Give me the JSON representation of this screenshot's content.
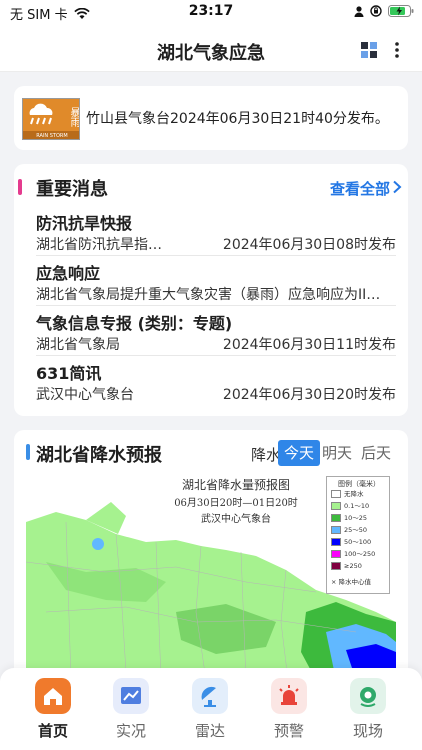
{
  "status_bar": {
    "carrier": "无 SIM 卡",
    "time": "23:17"
  },
  "nav": {
    "title": "湖北气象应急"
  },
  "notice": {
    "icon_text": "暴雨",
    "icon_banner": "RAIN STORM",
    "text": "竹山县气象台2024年06月30日21时40分发布。"
  },
  "news": {
    "title": "重要消息",
    "view_all": "查看全部",
    "items": [
      {
        "title": "防汛抗旱快报",
        "source": "湖北省防汛抗旱指…",
        "date": "2024年06月30日08时发布"
      },
      {
        "title": "应急响应",
        "source": "湖北省气象局提升重大气象灾害（暴雨）应急响应为II…",
        "date": ""
      },
      {
        "title": "气象信息专报 (类别：专题)",
        "source": "湖北省气象局",
        "date": "2024年06月30日11时发布"
      },
      {
        "title": "631简讯",
        "source": "武汉中心气象台",
        "date": "2024年06月30日20时发布"
      }
    ]
  },
  "rain": {
    "title": "湖北省降水预报",
    "label": "降水:",
    "tabs": [
      "今天",
      "明天",
      "后天"
    ],
    "active_tab": 0,
    "map": {
      "title": "湖北省降水量预报图",
      "subtitle": "06月30日20时—01日20时",
      "org": "武汉中心气象台",
      "legend_title": "图例（毫米）",
      "legend": [
        {
          "label": "无降水",
          "color": "#ffffff"
        },
        {
          "label": "0.1～10",
          "color": "#a6f28f"
        },
        {
          "label": "10～25",
          "color": "#3dba3d"
        },
        {
          "label": "25～50",
          "color": "#61b8ff"
        },
        {
          "label": "50～100",
          "color": "#0000fe"
        },
        {
          "label": "100～250",
          "color": "#fa00fa"
        },
        {
          "label": "≥250",
          "color": "#800040"
        }
      ],
      "center_label": "× 降水中心值"
    }
  },
  "tabbar": {
    "items": [
      {
        "label": "首页",
        "icon": "home-icon",
        "color": "#f07a2c"
      },
      {
        "label": "实况",
        "icon": "trend-chart-icon",
        "color": "#4f7ee0"
      },
      {
        "label": "雷达",
        "icon": "radar-icon",
        "color": "#3a8ee6"
      },
      {
        "label": "预警",
        "icon": "alarm-icon",
        "color": "#e8443a"
      },
      {
        "label": "现场",
        "icon": "location-icon",
        "color": "#2fa96a"
      }
    ],
    "active": 0
  }
}
